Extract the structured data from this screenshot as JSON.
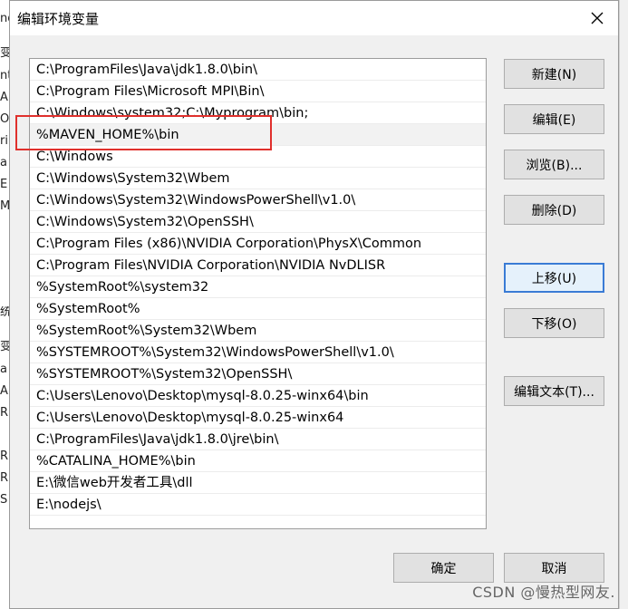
{
  "dialog": {
    "title": "编辑环境变量",
    "close_label": "×"
  },
  "paths": [
    "C:\\ProgramFiles\\Java\\jdk1.8.0\\bin\\",
    "C:\\Program Files\\Microsoft MPI\\Bin\\",
    "C:\\Windows\\system32;C:\\Myprogram\\bin;",
    "%MAVEN_HOME%\\bin",
    "C:\\Windows",
    "C:\\Windows\\System32\\Wbem",
    "C:\\Windows\\System32\\WindowsPowerShell\\v1.0\\",
    "C:\\Windows\\System32\\OpenSSH\\",
    "C:\\Program Files (x86)\\NVIDIA Corporation\\PhysX\\Common",
    "C:\\Program Files\\NVIDIA Corporation\\NVIDIA NvDLISR",
    "%SystemRoot%\\system32",
    "%SystemRoot%",
    "%SystemRoot%\\System32\\Wbem",
    "%SYSTEMROOT%\\System32\\WindowsPowerShell\\v1.0\\",
    "%SYSTEMROOT%\\System32\\OpenSSH\\",
    "C:\\Users\\Lenovo\\Desktop\\mysql-8.0.25-winx64\\bin",
    "C:\\Users\\Lenovo\\Desktop\\mysql-8.0.25-winx64",
    "C:\\ProgramFiles\\Java\\jdk1.8.0\\jre\\bin\\",
    "%CATALINA_HOME%\\bin",
    "E:\\微信web开发者工具\\dll",
    "E:\\nodejs\\"
  ],
  "selected_index": 3,
  "buttons": {
    "new": "新建(N)",
    "edit": "编辑(E)",
    "browse": "浏览(B)...",
    "delete": "删除(D)",
    "move_up": "上移(U)",
    "move_down": "下移(O)",
    "edit_text": "编辑文本(T)...",
    "ok": "确定",
    "cancel": "取消"
  },
  "background_fragments": [
    "nd",
    "变",
    "nt",
    "A",
    "Or",
    "ri",
    "a",
    "E",
    "M",
    "统",
    "变",
    "a",
    "A",
    "R",
    "R",
    "R",
    "S"
  ],
  "watermark": "CSDN @慢热型网友.",
  "colors": {
    "highlight": "#e0302c",
    "focus_border": "#3a7bd5"
  }
}
